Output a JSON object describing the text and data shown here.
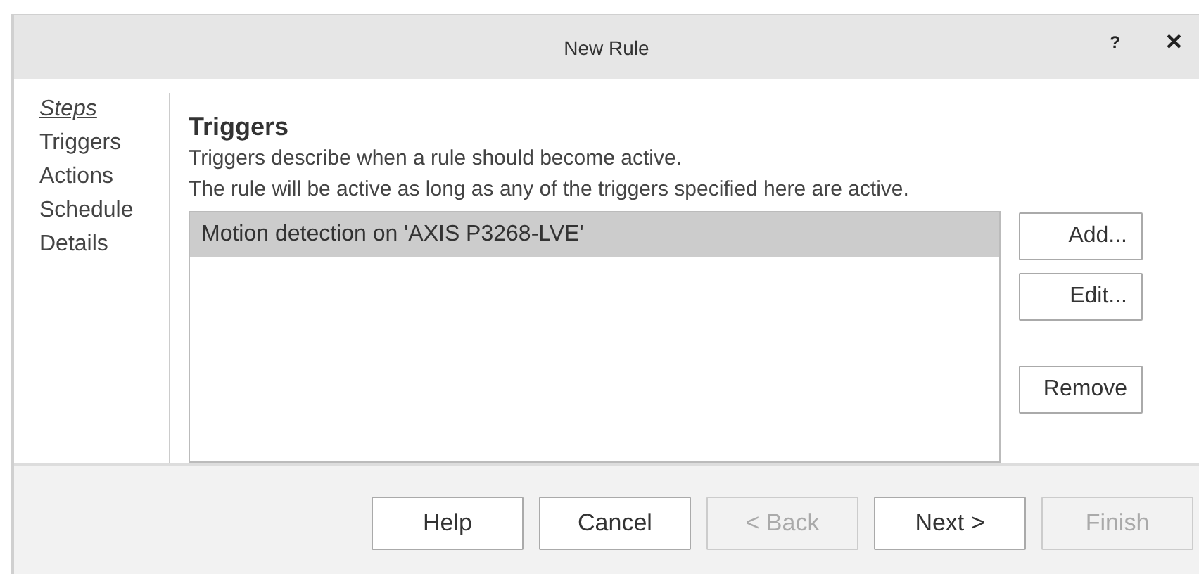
{
  "window": {
    "title": "New Rule",
    "help_button": "?",
    "close_button": "×"
  },
  "steps": {
    "heading": "Steps",
    "items": [
      "Triggers",
      "Actions",
      "Schedule",
      "Details"
    ]
  },
  "page": {
    "title": "Triggers",
    "description": [
      "Triggers describe when a rule should become active.",
      "The rule will be active as long as any of the triggers specified here are active."
    ]
  },
  "triggers": [
    {
      "label": "Motion detection on 'AXIS P3268-LVE'",
      "selected": true
    }
  ],
  "side_buttons": [
    {
      "label": "Add..."
    },
    {
      "label": "Edit..."
    },
    {
      "label": "Remove"
    }
  ],
  "footer_buttons": [
    {
      "label": "Help",
      "disabled": false
    },
    {
      "label": "Cancel",
      "disabled": false
    },
    {
      "label": "< Back",
      "disabled": true
    },
    {
      "label": "Next >",
      "disabled": false
    },
    {
      "label": "Finish",
      "disabled": true
    }
  ]
}
